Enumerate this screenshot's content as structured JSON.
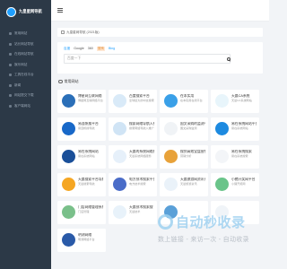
{
  "sidebar": {
    "logo_text": "九皇星网导航",
    "items": [
      {
        "label": "常用网站"
      },
      {
        "label": "站长网站导航"
      },
      {
        "label": "在线网站导航"
      },
      {
        "label": "娱乐网站"
      },
      {
        "label": "工具在线平台"
      },
      {
        "label": "新闻"
      },
      {
        "label": "网站提交下载"
      },
      {
        "label": "客户端网站"
      }
    ]
  },
  "notice": {
    "text": "九皇星网导航 (2021版)"
  },
  "search": {
    "engines": [
      {
        "label": "百度",
        "active": true,
        "highlight": false
      },
      {
        "label": "Google",
        "active": false,
        "highlight": false
      },
      {
        "label": "360",
        "active": false,
        "highlight": false
      },
      {
        "label": "搜狗",
        "active": false,
        "highlight": true
      },
      {
        "label": "Bing",
        "active": false,
        "highlight": false
      }
    ],
    "placeholder": "百度一下"
  },
  "section": {
    "title": "常用网站"
  },
  "sites": [
    {
      "name": "博星网互联网络",
      "desc": "博星网互联网络平台",
      "color": "#2b6fb8"
    },
    {
      "name": "百度搜索平台",
      "desc": "全球最大的中文搜索引擎",
      "color": "#d9eaf8"
    },
    {
      "name": "在本实用",
      "desc": "在本实用在线平台",
      "color": "#3aa0e8"
    },
    {
      "name": "天晨CA系统",
      "desc": "天晨CA系统网站",
      "color": "#e8f5fb"
    },
    {
      "name": "易连帆搜平台",
      "desc": "易连帆搜导航",
      "color": "#1868c8"
    },
    {
      "name": "搜索网络导航入推广",
      "desc": "搜索网络导航入推广",
      "color": "#d0e4f5"
    },
    {
      "name": "国文采购的监测平台",
      "desc": "国文采购监测",
      "color": "#f0f3f6"
    },
    {
      "name": "易在系统网站平台",
      "desc": "易在系统网站",
      "color": "#1d8ae0"
    },
    {
      "name": "易在系统网站",
      "desc": "易在系统网站",
      "color": "#1a4f99"
    },
    {
      "name": "天晨的系统网络服务",
      "desc": "天晨系统网络服务",
      "color": "#e6f0fa"
    },
    {
      "name": "搜到高效宝盘营销分析",
      "desc": "营销分析",
      "color": "#e8a23a"
    },
    {
      "name": "易在系统搜索",
      "desc": "易在系统搜索",
      "color": "#f3f5f8"
    },
    {
      "name": "天晨搜索平台导航",
      "desc": "天晨搜索导航",
      "color": "#f5a623"
    },
    {
      "name": "电方技术搜索平台",
      "desc": "电方技术搜索",
      "color": "#4a6cc8"
    },
    {
      "name": "天晨旅游网资讯系统",
      "desc": "天晨旅游资讯",
      "color": "#eaf2f9"
    },
    {
      "name": "小猪开奖网平台",
      "desc": "小猪开奖网",
      "color": "#6ac48a"
    },
    {
      "name": "门店网络管理系统",
      "desc": "门店管理",
      "color": "#7ac08a"
    },
    {
      "name": "天晨技术搜索搜",
      "desc": "天晨技术",
      "color": "#e8f2fa"
    },
    {
      "name": "",
      "desc": "",
      "color": "#5aa0d8"
    },
    {
      "name": "",
      "desc": "",
      "color": "#f0f4f8"
    },
    {
      "name": "明测网络",
      "desc": "明测网络平台",
      "color": "#2a5aa8"
    }
  ],
  "watermark": {
    "main": "自动秒收录",
    "sub": "数上链接 - 来访一次 - 自动收录"
  }
}
